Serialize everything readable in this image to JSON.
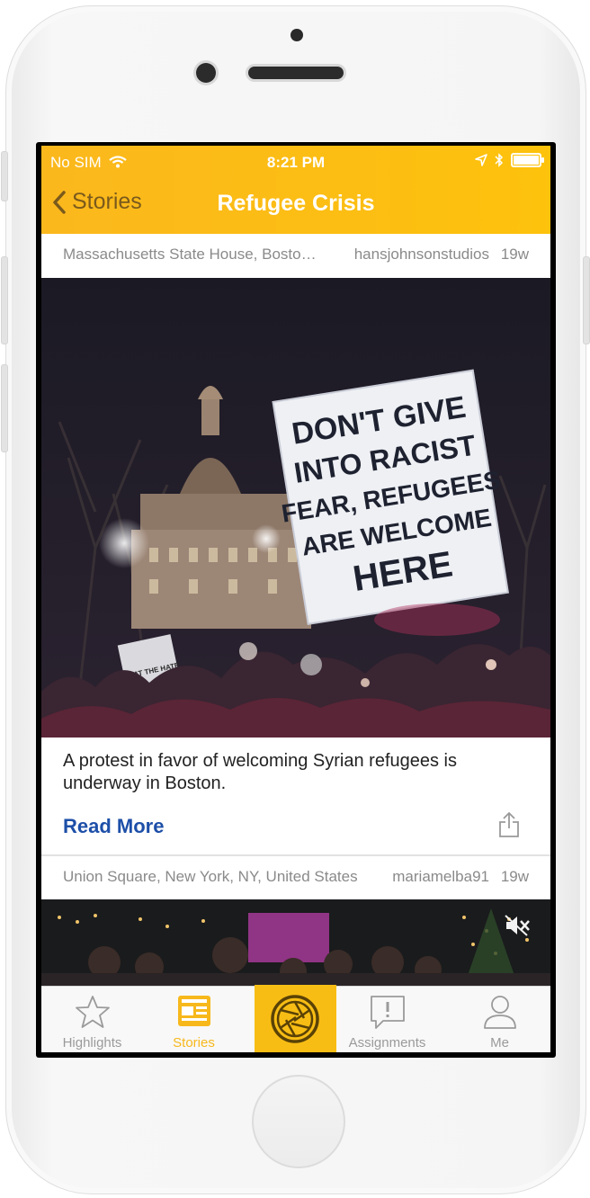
{
  "status_bar": {
    "carrier": "No SIM",
    "time": "8:21 PM"
  },
  "nav": {
    "back_label": "Stories",
    "title": "Refugee Crisis"
  },
  "posts": [
    {
      "location": "Massachusetts State House, Bosto…",
      "user": "hansjohnsonstudios",
      "age": "19w",
      "sign_lines": [
        "DON'T GIVE",
        "INTO RACIST",
        "FEAR, REFUGEES",
        "ARE WELCOME",
        "HERE"
      ],
      "small_sign": "WHAT THE HATE",
      "caption": "A protest in favor of welcoming Syrian refugees is underway in Boston.",
      "read_more": "Read More"
    },
    {
      "location": "Union Square, New York, NY, United States",
      "user": "mariamelba91",
      "age": "19w"
    }
  ],
  "tabs": [
    {
      "label": "Highlights",
      "icon": "star-icon"
    },
    {
      "label": "Stories",
      "icon": "newspaper-icon",
      "active": true
    },
    {
      "label": "",
      "icon": "camera-shutter-icon"
    },
    {
      "label": "Assignments",
      "icon": "alert-bubble-icon"
    },
    {
      "label": "Me",
      "icon": "person-icon"
    }
  ],
  "colors": {
    "header": "#fdc20c",
    "link": "#1d4fa8",
    "tab_active": "#f7b81c"
  }
}
